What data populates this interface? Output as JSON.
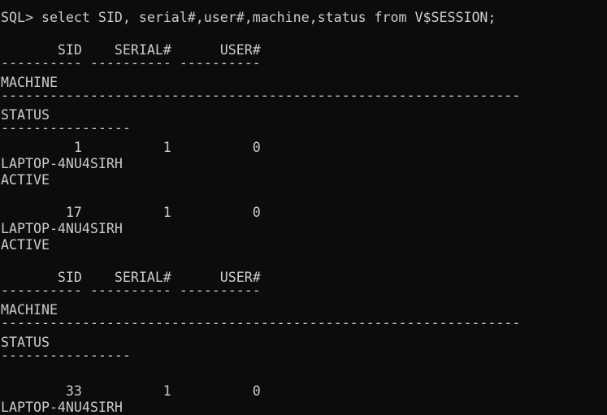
{
  "console": {
    "prompt": "SQL> ",
    "command": "select SID, serial#,user#,machine,status from V$SESSION;",
    "lines": [
      "",
      "       SID    SERIAL#      USER#",
      "---------- ---------- ----------",
      "MACHINE",
      "----------------------------------------------------------------",
      "STATUS",
      "----------------",
      "         1          1          0",
      "LAPTOP-4NU4SIRH",
      "ACTIVE",
      "",
      "        17          1          0",
      "LAPTOP-4NU4SIRH",
      "ACTIVE",
      "",
      "       SID    SERIAL#      USER#",
      "---------- ---------- ----------",
      "MACHINE",
      "----------------------------------------------------------------",
      "STATUS",
      "----------------",
      "",
      "",
      "        33          1          0",
      "LAPTOP-4NU4SIRH"
    ]
  }
}
